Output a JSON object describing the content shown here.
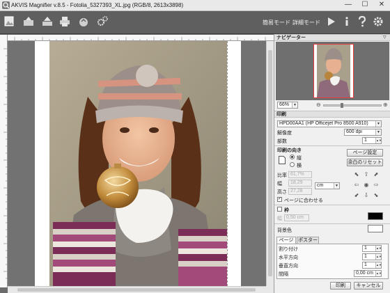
{
  "window": {
    "title": "AKVIS Magnifier v.8.5 - Fotolia_5327393_XL.jpg (RGB/8, 2613x3898)",
    "minimize": "—",
    "maximize": "☐",
    "close": "✕"
  },
  "toolbar": {
    "left_icons": [
      "open-image-icon",
      "save-icon",
      "publish-icon",
      "print-icon",
      "undo-icon",
      "settings-gears-icon"
    ],
    "simple_mode": "簡易モード",
    "advanced_mode": "詳細モード",
    "right_icons": [
      "run-icon",
      "info-icon",
      "help-icon",
      "preferences-icon"
    ]
  },
  "navigator": {
    "header": "ナビゲーター",
    "zoom": "66%",
    "zoom_out": "⊖",
    "zoom_in": "⊕"
  },
  "print": {
    "header": "印刷",
    "printer": "HPD00AA1 (HP Officejet Pro 8500 A910)",
    "resolution_label": "解像度",
    "resolution": "600 dpi",
    "copies_label": "部数",
    "copies": "1",
    "orientation_header": "印刷の向き",
    "portrait_label": "縦",
    "landscape_label": "横",
    "page_setup_button": "ページ設定",
    "reset_margins_button": "余白のリセット",
    "ratio_label": "比率",
    "ratio_value": "61,7%",
    "width_label": "幅",
    "width_value": "18,29",
    "height_label": "高さ",
    "height_value": "27,28",
    "unit": "cm",
    "fit_to_page_label": "ページに合わせる",
    "fit_to_page_checked": true,
    "frame_label": "枠",
    "frame_width_label": "幅",
    "frame_width_value": "0,50 cm",
    "background_label": "背景色"
  },
  "tabs": {
    "page": "ページ",
    "poster": "ポスター"
  },
  "layout": {
    "split_label": "割り付け",
    "split_value": "1",
    "horizontal_label": "水平方向",
    "horizontal_value": "1",
    "vertical_label": "垂直方向",
    "vertical_value": "1",
    "spacing_label": "間隔",
    "spacing_value": "0,00 cm"
  },
  "buttons": {
    "print": "印刷",
    "cancel": "キャンセル"
  },
  "colors": {
    "toolbar": "#5f5f5f",
    "panel": "#f0f0f0",
    "frame_color": "#000000",
    "background_color": "#ffffff"
  }
}
